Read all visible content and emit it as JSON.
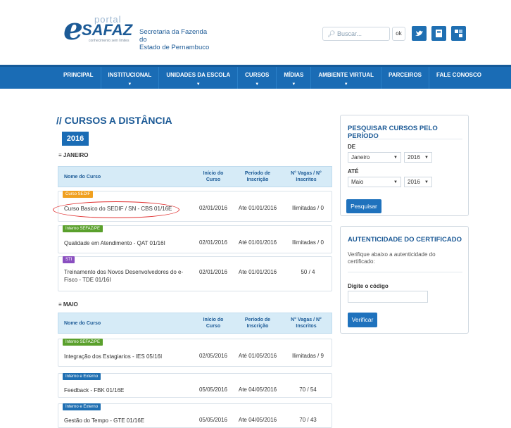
{
  "header": {
    "logo_portal": "portal",
    "logo_e": "e",
    "logo_safaz": "SAFAZ",
    "logo_tagline": "conhecimento sem limites",
    "secretaria_line1": "Secretaria da Fazenda do",
    "secretaria_line2": "Estado de Pernambuco",
    "search_placeholder": "Buscar...",
    "search_button": "ok"
  },
  "nav": {
    "items": [
      {
        "label": "PRINCIPAL",
        "caret": false
      },
      {
        "label": "INSTITUCIONAL",
        "caret": true
      },
      {
        "label": "UNIDADES DA ESCOLA",
        "caret": true
      },
      {
        "label": "CURSOS",
        "caret": true
      },
      {
        "label": "MÍDIAS",
        "caret": true
      },
      {
        "label": "AMBIENTE VIRTUAL",
        "caret": true
      },
      {
        "label": "PARCEIROS",
        "caret": false
      },
      {
        "label": "FALE CONOSCO",
        "caret": false
      }
    ]
  },
  "main": {
    "title": "// CURSOS A DISTÂNCIA",
    "year": "2016",
    "table_headers": {
      "name": "Nome do Curso",
      "start": "Início do Curso",
      "period": "Período de Inscrição",
      "vagas": "N° Vagas / N° Inscritos"
    },
    "months": [
      {
        "label": "≡ JANEIRO",
        "courses": [
          {
            "badge": "Curso SEDIF",
            "badge_color": "#f0a020",
            "name": "Curso Basico do SEDIF / SN - CBS 01/16E",
            "start": "02/01/2016",
            "period": "Ate 01/01/2016",
            "vagas": "Ilimitadas / 0"
          },
          {
            "badge": "Interno SEFAZ/PE",
            "badge_color": "#5aa02c",
            "name": "Qualidade em Atendimento - QAT 01/16I",
            "start": "02/01/2016",
            "period": "Até 01/01/2016",
            "vagas": "Ilimitadas / 0"
          },
          {
            "badge": "STI",
            "badge_color": "#8a4fc0",
            "name": "Treinamento dos Novos Desenvolvedores do e-Fisco - TDE 01/16I",
            "start": "02/01/2016",
            "period": "Ate 01/01/2016",
            "vagas": "50 / 4"
          }
        ]
      },
      {
        "label": "≡ MAIO",
        "courses": [
          {
            "badge": "Interno SEFAZ/PE",
            "badge_color": "#5aa02c",
            "name": "Integração dos Estagiarios - IES 05/16I",
            "start": "02/05/2016",
            "period": "Até 01/05/2016",
            "vagas": "Ilimitadas / 9"
          },
          {
            "badge": "Interno e Externo",
            "badge_color": "#1f6fb2",
            "name": "Feedback - FBK 01/16E",
            "start": "05/05/2016",
            "period": "Ate 04/05/2016",
            "vagas": "70 / 54"
          },
          {
            "badge": "Interno e Externo",
            "badge_color": "#1f6fb2",
            "name": "Gestão do Tempo - GTE 01/16E",
            "start": "05/05/2016",
            "period": "Ate 04/05/2016",
            "vagas": "70 / 43"
          }
        ]
      }
    ]
  },
  "sidebar": {
    "period_box": {
      "title": "PESQUISAR CURSOS PELO PERÍODO",
      "de_label": "DE",
      "de_month": "Janeiro",
      "de_year": "2016",
      "ate_label": "ATÉ",
      "ate_month": "Maio",
      "ate_year": "2016",
      "button": "Pesquisar"
    },
    "cert_box": {
      "title": "AUTENTICIDADE DO CERTIFICADO",
      "text": "Verifique abaixo a autenticidade do certificado:",
      "code_label": "Digite o código",
      "button": "Verificar"
    }
  },
  "colors": {
    "primary": "#1a6cb5",
    "title": "#1c5a96",
    "highlight": "#e03030"
  }
}
